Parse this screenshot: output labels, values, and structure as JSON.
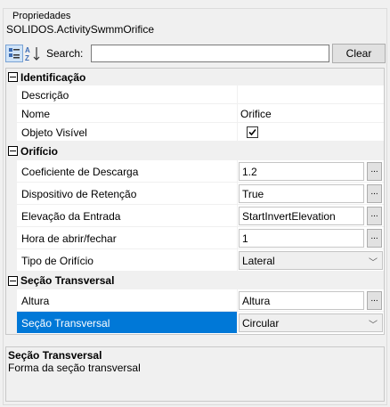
{
  "panel": {
    "group_label": "Propriedades",
    "object_title": "SOLIDOS.ActivitySwmmOrifice"
  },
  "toolbar": {
    "categorized_icon": "categorized-icon",
    "alphabetical_icon": "alphabetical-icon",
    "search_label": "Search:",
    "search_value": "",
    "clear_label": "Clear"
  },
  "categories": [
    {
      "label": "Identificação",
      "rows": [
        {
          "name": "Descrição",
          "value": ""
        },
        {
          "name": "Nome",
          "value": "Orifice"
        },
        {
          "name": "Objeto Visível",
          "checked": true
        }
      ]
    },
    {
      "label": "Orifício",
      "rows": [
        {
          "name": "Coeficiente de Descarga",
          "value": "1.2"
        },
        {
          "name": "Dispositivo de Retenção",
          "value": "True"
        },
        {
          "name": "Elevação da Entrada",
          "value": "StartInvertElevation"
        },
        {
          "name": "Hora de abrir/fechar",
          "value": "1"
        },
        {
          "name": "Tipo de Orifício",
          "value": "Lateral"
        }
      ]
    },
    {
      "label": "Seção Transversal",
      "rows": [
        {
          "name": "Altura",
          "value": "Altura"
        },
        {
          "name": "Seção Transversal",
          "value": "Circular"
        }
      ]
    }
  ],
  "ellipsis": "...",
  "chevron": "﹀",
  "help": {
    "title": "Seção Transversal",
    "description": "Forma da seção transversal"
  },
  "colors": {
    "selection": "#0078d7"
  }
}
